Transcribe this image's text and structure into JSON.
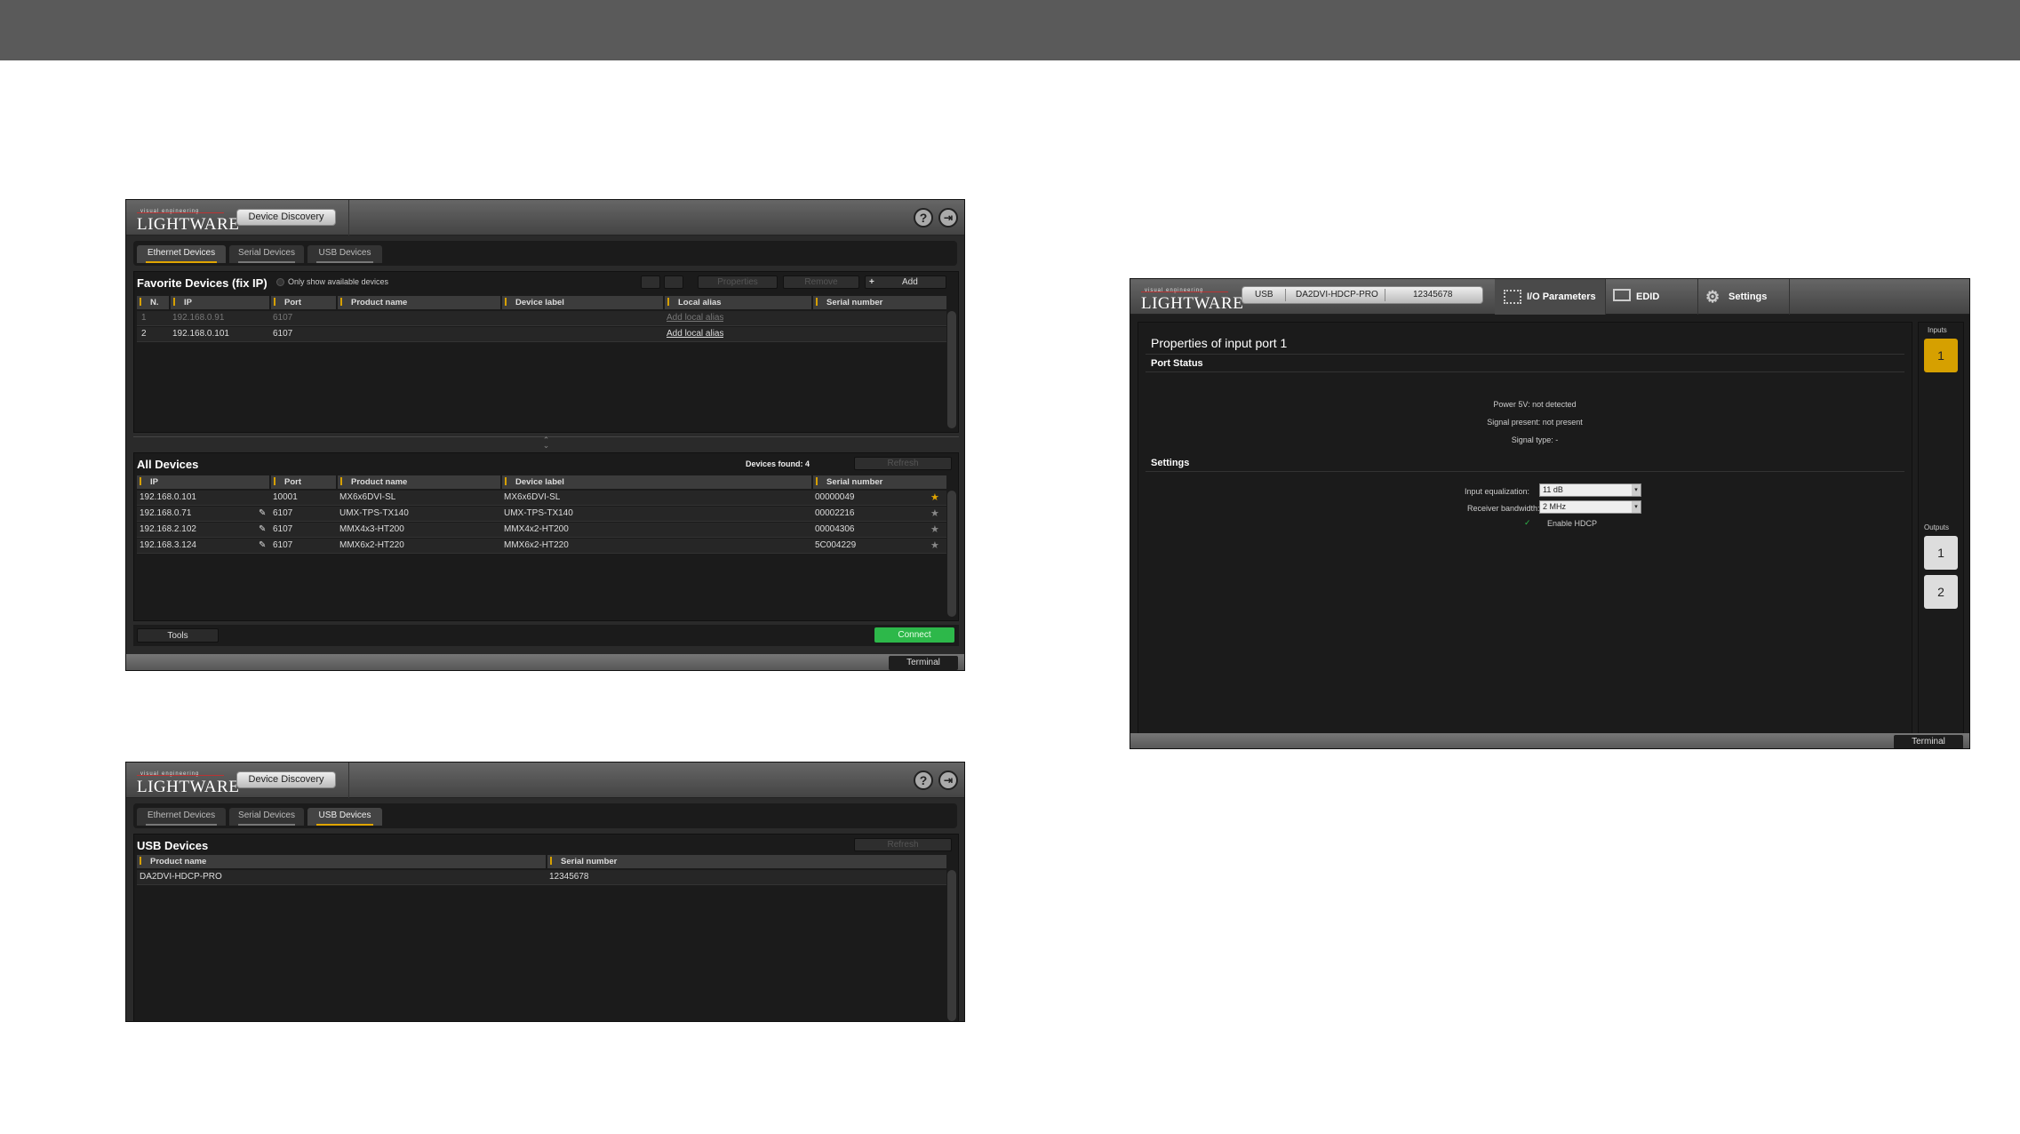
{
  "window1": {
    "logo_small": "visual engineering",
    "logo": "LIGHTWARE",
    "nav_button": "Device Discovery",
    "help_icon": "?",
    "exit_icon": "⇥",
    "tabs": [
      "Ethernet Devices",
      "Serial Devices",
      "USB Devices"
    ],
    "favorites": {
      "title": "Favorite Devices (fix IP)",
      "only_show": "Only show available devices",
      "btn_properties": "Properties",
      "btn_remove": "Remove",
      "btn_add": "Add",
      "columns": [
        "N.",
        "IP",
        "Port",
        "Product name",
        "Device label",
        "Local alias",
        "Serial number"
      ],
      "rows": [
        {
          "n": "1",
          "ip": "192.168.0.91",
          "port": "6107",
          "product": "",
          "label": "",
          "alias": "Add local alias",
          "serial": ""
        },
        {
          "n": "2",
          "ip": "192.168.0.101",
          "port": "6107",
          "product": "",
          "label": "",
          "alias": "Add local alias",
          "serial": ""
        }
      ]
    },
    "all": {
      "title": "All Devices",
      "found": "Devices found: 4",
      "btn_refresh": "Refresh",
      "columns": [
        "IP",
        "Port",
        "Product name",
        "Device label",
        "Serial number"
      ],
      "rows": [
        {
          "ip": "192.168.0.101",
          "port": "10001",
          "product": "MX6x6DVI-SL",
          "label": "MX6x6DVI-SL",
          "serial": "00000049",
          "fav": true
        },
        {
          "ip": "192.168.0.71",
          "port": "6107",
          "product": "UMX-TPS-TX140",
          "label": "UMX-TPS-TX140",
          "serial": "00002216",
          "fav": false
        },
        {
          "ip": "192.168.2.102",
          "port": "6107",
          "product": "MMX4x3-HT200",
          "label": "MMX4x2-HT200",
          "serial": "00004306",
          "fav": false
        },
        {
          "ip": "192.168.3.124",
          "port": "6107",
          "product": "MMX6x2-HT220",
          "label": "MMX6x2-HT220",
          "serial": "5C004229",
          "fav": false
        }
      ]
    },
    "tools": "Tools",
    "connect": "Connect",
    "terminal": "Terminal"
  },
  "window2": {
    "logo_small": "visual engineering",
    "logo": "LIGHTWARE",
    "nav_button": "Device Discovery",
    "help_icon": "?",
    "exit_icon": "⇥",
    "tabs": [
      "Ethernet Devices",
      "Serial Devices",
      "USB Devices"
    ],
    "title": "USB Devices",
    "btn_refresh": "Refresh",
    "columns": [
      "Product name",
      "Serial number"
    ],
    "rows": [
      {
        "product": "DA2DVI-HDCP-PRO",
        "serial": "12345678"
      }
    ]
  },
  "window3": {
    "logo_small": "visual engineering",
    "logo": "LIGHTWARE",
    "device_bar": [
      "USB",
      "DA2DVI-HDCP-PRO",
      "12345678"
    ],
    "menu": [
      "I/O Parameters",
      "EDID",
      "Settings"
    ],
    "title": "Properties of input port 1",
    "port_status_heading": "Port Status",
    "status_lines": [
      "Power 5V: not detected",
      "Signal present: not present",
      "Signal type: -"
    ],
    "settings_heading": "Settings",
    "eq_label": "Input equalization:",
    "eq_value": "11 dB",
    "bw_label": "Receiver bandwidth:",
    "bw_value": "2 MHz",
    "hdcp_label": "Enable HDCP",
    "inputs_label": "Inputs",
    "inputs": [
      "1"
    ],
    "outputs_label": "Outputs",
    "outputs": [
      "1",
      "2"
    ],
    "terminal": "Terminal",
    "accent": "#d6a000"
  }
}
